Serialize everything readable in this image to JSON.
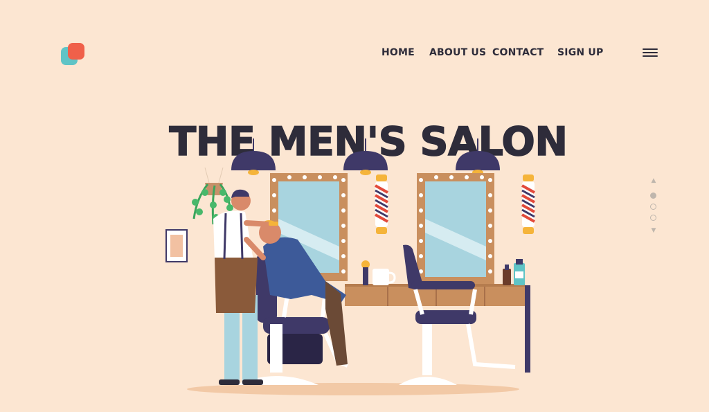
{
  "header": {
    "logo": {
      "colors": [
        "#5fc4c6",
        "#f0604a"
      ]
    },
    "nav": [
      {
        "label": "HOME"
      },
      {
        "label": "ABOUT US"
      },
      {
        "label": "CONTACT"
      },
      {
        "label": "SIGN UP"
      }
    ],
    "menu_icon": "hamburger-menu-icon"
  },
  "hero": {
    "title": "THE MEN'S SALON",
    "illustration": "barbershop-scene"
  },
  "pager": {
    "up_icon": "▲",
    "down_icon": "▼",
    "dots": 3,
    "active_index": 0
  },
  "colors": {
    "background": "#fce6d2",
    "text": "#2e2c3a",
    "accent_red": "#f0604a",
    "accent_teal": "#5fc4c6"
  }
}
